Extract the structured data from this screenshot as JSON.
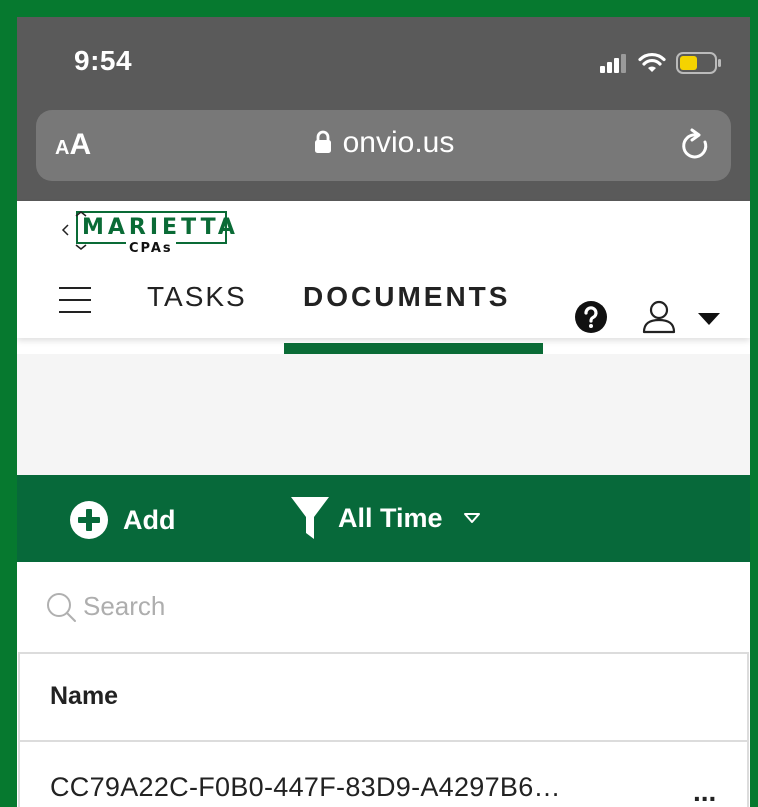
{
  "status_bar": {
    "time": "9:54"
  },
  "browser": {
    "text_size_small": "A",
    "text_size_big": "A",
    "url": "onvio.us"
  },
  "app": {
    "logo": {
      "name": "MARIETTA",
      "sub": "CPAs"
    },
    "nav": {
      "tabs": [
        {
          "label": "TASKS",
          "active": false
        },
        {
          "label": "DOCUMENTS",
          "active": true
        }
      ]
    },
    "toolbar": {
      "add_label": "Add",
      "filter_label": "All Time"
    },
    "search": {
      "placeholder": "Search"
    },
    "table": {
      "columns": [
        "Name"
      ],
      "rows": [
        {
          "name": "CC79A22C-F0B0-447F-83D9-A4297B6…",
          "more": "..."
        }
      ]
    }
  },
  "colors": {
    "brand_green": "#07693a",
    "page_background": "#06792f",
    "browser_chrome": "#5a5a5a"
  },
  "icons": [
    "lock-icon",
    "reload-icon",
    "menu-icon",
    "help-icon",
    "user-icon",
    "caret-down-icon",
    "add-icon",
    "filter-icon",
    "search-icon"
  ]
}
